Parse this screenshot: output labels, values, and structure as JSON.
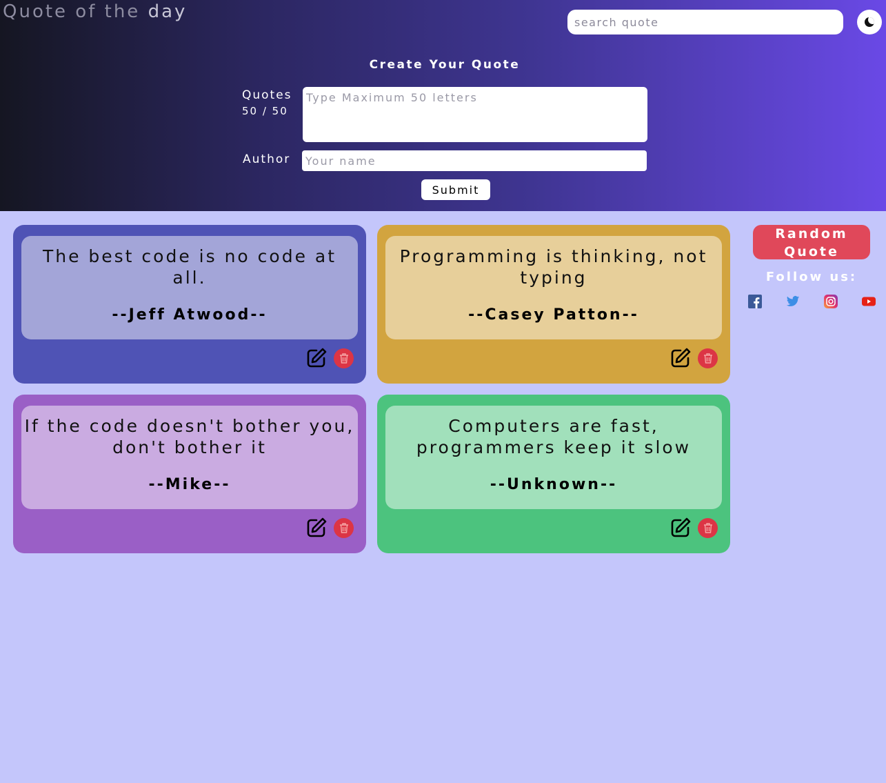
{
  "header": {
    "title_prefix": "Quote of the ",
    "title_highlight": "day",
    "search_placeholder": "search quote",
    "theme_toggle": "moon-icon"
  },
  "form": {
    "title": "Create Your Quote",
    "quotes_label": "Quotes",
    "count": "50 / 50",
    "quote_placeholder": "Type Maximum 50 letters",
    "author_label": "Author",
    "author_placeholder": "Your name",
    "submit_label": "Submit"
  },
  "quotes": [
    {
      "text": "The best code is no code at all.",
      "author": "--Jeff Atwood--",
      "color": "#4f53b5"
    },
    {
      "text": "Programming is thinking, not typing",
      "author": "--Casey Patton--",
      "color": "#d2a43f"
    },
    {
      "text": "If the code doesn't bother you, don't bother it",
      "author": "--Mike--",
      "color": "#9a5fc6"
    },
    {
      "text": "Computers are fast, programmers keep it slow",
      "author": "--Unknown--",
      "color": "#4cc37e"
    }
  ],
  "sidebar": {
    "random_label": "Random Quote",
    "follow_label": "Follow us:",
    "social": [
      {
        "icon": "facebook-icon",
        "color": "#3b5998"
      },
      {
        "icon": "twitter-icon",
        "color": "#1da1f2"
      },
      {
        "icon": "instagram-icon",
        "color": "#c13584"
      },
      {
        "icon": "youtube-icon",
        "color": "#ff0000"
      }
    ]
  },
  "colors": {
    "background": "#c4c6fb",
    "delete": "#dc3545",
    "random_button": "#e0485a"
  }
}
